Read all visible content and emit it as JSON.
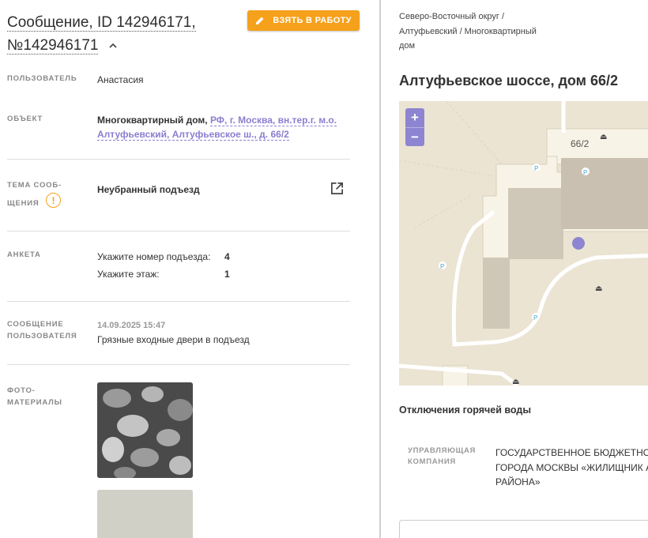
{
  "header": {
    "title_line1": "Сообщение, ID 142946171,",
    "title_line2": "№142946171",
    "take_button": "ВЗЯТЬ В РАБОТУ"
  },
  "fields": {
    "user_label": "ПОЛЬЗОВАТЕЛЬ",
    "user_value": "Анастасия",
    "object_label": "ОБЪЕКТ",
    "object_type": "Многоквартирный дом,",
    "object_link_line1": "РФ, г. Москва, вн.тер.г. м.о.",
    "object_link_line2": "Алтуфьевский, Алтуфьевское ш., д. 66/2",
    "topic_label_line1": "ТЕМА СООБ-",
    "topic_label_line2": "ЩЕНИЯ",
    "topic_value": "Неубранный подъезд",
    "survey_label": "АНКЕТА",
    "survey": [
      {
        "q": "Укажите номер подъезда:",
        "a": "4"
      },
      {
        "q": "Укажите этаж:",
        "a": "1"
      }
    ],
    "message_label_line1": "СООБЩЕНИЕ",
    "message_label_line2": "ПОЛЬЗОВАТЕЛЯ",
    "message_date": "14.09.2025 15:47",
    "message_text": "Грязные входные двери в подъезд",
    "photos_label_line1": "ФОТО-",
    "photos_label_line2": "МАТЕРИАЛЫ"
  },
  "right": {
    "crumbs_line1": "Северо-Восточный округ /",
    "crumbs_line2": "Алтуфьевский / Многоквартирный",
    "crumbs_line3": "дом",
    "address": "Алтуфьевское шоссе, дом 66/2",
    "map_house_number": "66/2",
    "zoom_in": "+",
    "zoom_out": "−",
    "hot_water_title": "Отключения горячей воды",
    "mc_label_line1": "УПРАВЛЯЮЩАЯ",
    "mc_label_line2": "КОМПАНИЯ",
    "mc_value_line1": "ГОСУДАРСТВЕННОЕ БЮДЖЕТНОЕ",
    "mc_value_line2": "ГОРОДА МОСКВЫ «ЖИЛИЩНИК А",
    "mc_value_line3": "РАЙОНА»"
  },
  "colors": {
    "accent": "#f5a11c",
    "link": "#8a7fd0",
    "marker": "#8d85d1"
  }
}
